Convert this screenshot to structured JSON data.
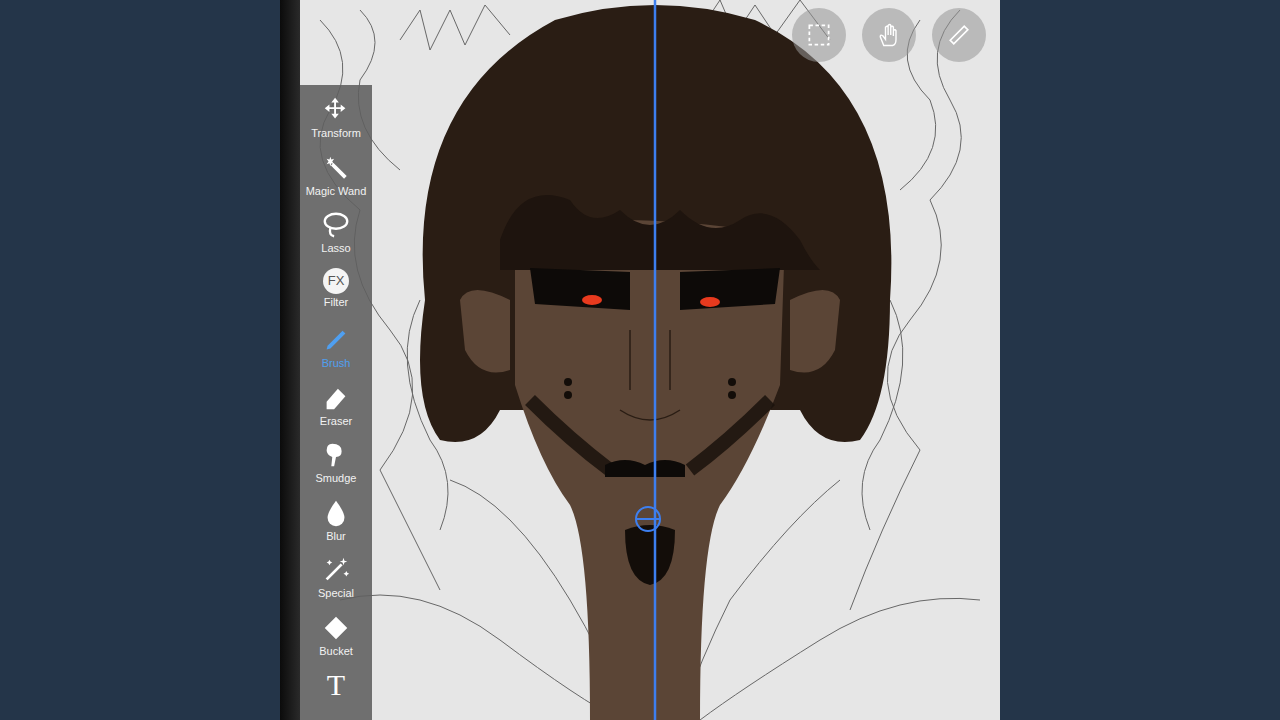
{
  "toolbar": {
    "tools": [
      {
        "label": "Transform",
        "selected": false
      },
      {
        "label": "Magic Wand",
        "selected": false
      },
      {
        "label": "Lasso",
        "selected": false
      },
      {
        "label": "Filter",
        "selected": false,
        "glyph": "FX"
      },
      {
        "label": "Brush",
        "selected": true
      },
      {
        "label": "Eraser",
        "selected": false
      },
      {
        "label": "Smudge",
        "selected": false
      },
      {
        "label": "Blur",
        "selected": false
      },
      {
        "label": "Special",
        "selected": false
      },
      {
        "label": "Bucket",
        "selected": false
      },
      {
        "label": "",
        "selected": false,
        "glyph": "T"
      }
    ]
  },
  "top_buttons": [
    {
      "name": "selection"
    },
    {
      "name": "hand"
    },
    {
      "name": "ruler"
    }
  ]
}
